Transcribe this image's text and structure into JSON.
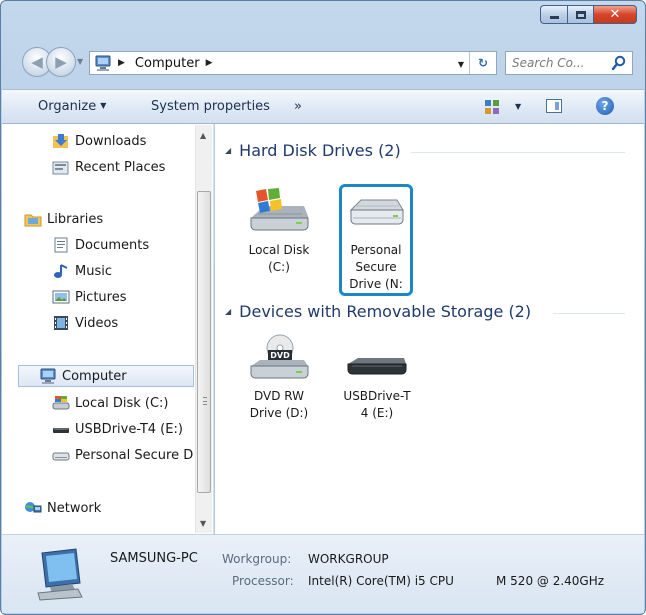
{
  "address": {
    "breadcrumb": "Computer",
    "search_placeholder": "Search Co..."
  },
  "toolbar": {
    "organize": "Organize",
    "system_properties": "System properties",
    "more": "»"
  },
  "nav": {
    "items": [
      {
        "label": "Downloads"
      },
      {
        "label": "Recent Places"
      },
      {
        "label": "Libraries"
      },
      {
        "label": "Documents"
      },
      {
        "label": "Music"
      },
      {
        "label": "Pictures"
      },
      {
        "label": "Videos"
      },
      {
        "label": "Computer"
      },
      {
        "label": "Local Disk (C:)"
      },
      {
        "label": "USBDrive-T4 (E:)"
      },
      {
        "label": "Personal Secure D"
      },
      {
        "label": "Network"
      }
    ]
  },
  "groups": [
    {
      "title": "Hard Disk Drives (2)"
    },
    {
      "title": "Devices with Removable Storage (2)"
    }
  ],
  "drives": [
    {
      "line1": "Local Disk",
      "line2": "(C:)",
      "line3": ""
    },
    {
      "line1": "Personal",
      "line2": "Secure",
      "line3": "Drive (N:"
    },
    {
      "line1": "DVD RW",
      "line2": "Drive (D:)",
      "line3": ""
    },
    {
      "line1": "USBDrive-T",
      "line2": "4 (E:)",
      "line3": ""
    }
  ],
  "details": {
    "name": "SAMSUNG-PC",
    "workgroup_label": "Workgroup:",
    "workgroup_value": "WORKGROUP",
    "processor_label": "Processor:",
    "processor_value": "Intel(R) Core(TM) i5 CPU",
    "processor_model": "M 520  @ 2.40GHz"
  },
  "colors": {
    "accent_selection": "#1b87c9",
    "group_header": "#1e3b6b"
  }
}
